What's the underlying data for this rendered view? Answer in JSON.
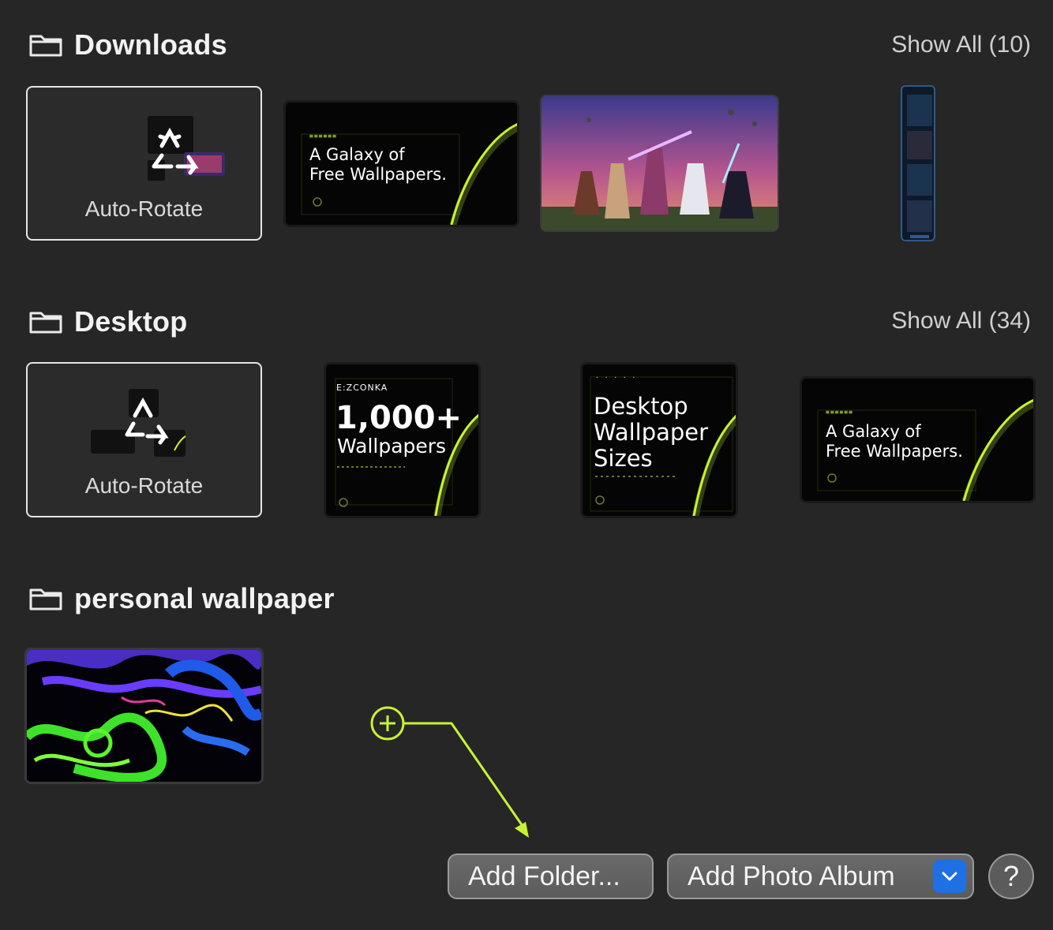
{
  "sections": [
    {
      "title": "Downloads",
      "show_all": "Show All (10)",
      "auto_rotate_label": "Auto-Rotate",
      "thumbnails": [
        {
          "kind": "promo",
          "line1": "A Galaxy of",
          "line2": "Free Wallpapers."
        },
        {
          "kind": "scene",
          "icon": "space-battle-image"
        },
        {
          "kind": "phone",
          "icon": "phone-screenshot-image"
        }
      ]
    },
    {
      "title": "Desktop",
      "show_all": "Show All (34)",
      "auto_rotate_label": "Auto-Rotate",
      "thumbnails": [
        {
          "kind": "promo",
          "brand": "E:ZCONKA",
          "line1": "1,000+",
          "line2": "Wallpapers"
        },
        {
          "kind": "promo",
          "line1": "Desktop",
          "line2": "Wallpaper",
          "line3": "Sizes"
        },
        {
          "kind": "promo",
          "line1": "A Galaxy of",
          "line2": "Free Wallpapers."
        }
      ]
    },
    {
      "title": "personal wallpaper",
      "thumbnails": [
        {
          "kind": "abstract",
          "icon": "neon-abstract-image"
        }
      ]
    }
  ],
  "footer": {
    "add_folder": "Add Folder...",
    "add_photo_album": "Add Photo Album",
    "help": "?"
  },
  "colors": {
    "background": "#262626",
    "accent_green": "#c6f432",
    "dropdown_blue": "#1f6fe5"
  }
}
